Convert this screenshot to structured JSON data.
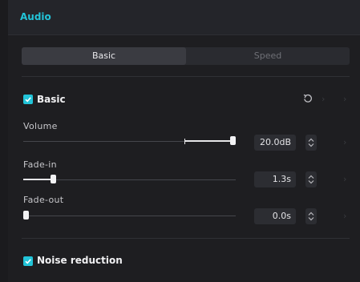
{
  "header": {
    "title": "Audio"
  },
  "tabs": [
    {
      "label": "Basic",
      "active": true
    },
    {
      "label": "Speed",
      "active": false
    }
  ],
  "basic_section": {
    "label": "Basic",
    "checked": true,
    "reset_icon": "reset-icon"
  },
  "volume": {
    "label": "Volume",
    "value": "20.0dB",
    "level": 1.0
  },
  "fade_in": {
    "label": "Fade-in",
    "value": "1.3s",
    "level": 0.13
  },
  "fade_out": {
    "label": "Fade-out",
    "value": "0.0s",
    "level": 0.0
  },
  "noise_section": {
    "label": "Noise reduction",
    "checked": true
  },
  "colors": {
    "accent": "#22c4d8",
    "panel": "#1e1e21",
    "header": "#24252a"
  }
}
